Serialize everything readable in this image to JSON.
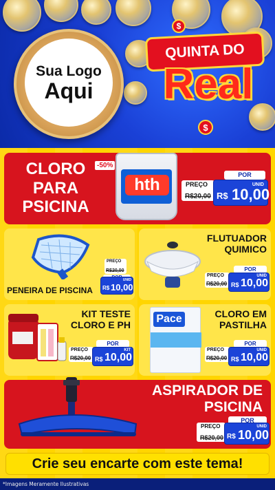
{
  "header": {
    "logo_line1": "Sua Logo",
    "logo_line2": "Aqui",
    "badge_line": "QUINTA DO",
    "badge_main": "Real",
    "badge_symbol": "$"
  },
  "products": [
    {
      "id": "cloro-para-psicina",
      "title_lines": [
        "CLORO",
        "PARA",
        "PSICINA"
      ],
      "discount": "-50%",
      "brand": "hth",
      "preco_label": "PREÇO",
      "old_price": "R$20,00",
      "por_label": "POR",
      "currency": "R$",
      "price": "10,00",
      "unit": "UNID"
    },
    {
      "id": "peneira-de-piscina",
      "title_lines": [
        "PENEIRA DE PISCINA"
      ],
      "preco_label": "PREÇO",
      "old_price": "R$20,00",
      "por_label": "POR",
      "currency": "R$",
      "price": "10,00",
      "unit": "UNID"
    },
    {
      "id": "flutuador-quimico",
      "title_lines": [
        "FLUTUADOR",
        "QUIMICO"
      ],
      "preco_label": "PREÇO",
      "old_price": "R$20,00",
      "por_label": "POR",
      "currency": "R$",
      "price": "10,00",
      "unit": "UNID"
    },
    {
      "id": "kit-teste-cloro-e-ph",
      "title_lines": [
        "KIT TESTE",
        "CLORO E PH"
      ],
      "preco_label": "PREÇO",
      "old_price": "R$20,00",
      "por_label": "POR",
      "currency": "R$",
      "price": "10,00",
      "unit": "KIT"
    },
    {
      "id": "cloro-em-pastilha",
      "title_lines": [
        "CLORO EM",
        "PASTILHA"
      ],
      "brand": "Pace",
      "preco_label": "PREÇO",
      "old_price": "R$20,00",
      "por_label": "POR",
      "currency": "R$",
      "price": "10,00",
      "unit": "UNID"
    },
    {
      "id": "aspirador-de-psicina",
      "title_lines": [
        "ASPIRADOR DE",
        "PSICINA"
      ],
      "preco_label": "PREÇO",
      "old_price": "R$20,00",
      "por_label": "POR",
      "currency": "R$",
      "price": "10,00",
      "unit": "UNID"
    }
  ],
  "footer": {
    "cta": "Crie seu encarte com este tema!",
    "disclaimer": "*Imagens Meramente Ilustrativas"
  },
  "colors": {
    "blue": "#1b44d8",
    "red": "#d7141e",
    "yellow": "#ffd500"
  }
}
